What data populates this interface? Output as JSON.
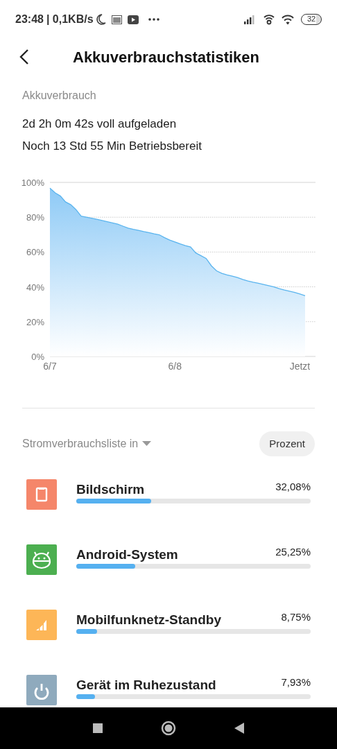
{
  "status_bar": {
    "time": "23:48",
    "speed": "| 0,1KB/s",
    "battery": "32"
  },
  "header": {
    "title": "Akkuverbrauchstatistiken"
  },
  "summary": {
    "label": "Akkuverbrauch",
    "charged": "2d 2h 0m 42s voll aufgeladen",
    "remaining": "Noch 13 Std 55 Min Betriebsbereit"
  },
  "chart_data": {
    "type": "area",
    "grid": true,
    "ylim": [
      0,
      100
    ],
    "categories": [
      "6/7",
      null,
      null,
      null,
      null,
      null,
      null,
      null,
      null,
      null,
      null,
      null,
      null,
      null,
      null,
      null,
      null,
      null,
      null,
      null,
      null,
      null,
      null,
      null,
      "6/8",
      null,
      null,
      null,
      null,
      null,
      null,
      null,
      null,
      null,
      null,
      null,
      null,
      null,
      null,
      null,
      null,
      null,
      null,
      null,
      null,
      null,
      null,
      null,
      "Jetzt",
      null
    ],
    "yticks": [
      {
        "value": 0,
        "label": "0%"
      },
      {
        "value": 20,
        "label": "20%"
      },
      {
        "value": 40,
        "label": "40%"
      },
      {
        "value": 60,
        "label": "60%"
      },
      {
        "value": 80,
        "label": "80%"
      },
      {
        "value": 100,
        "label": "100%"
      }
    ],
    "series": [
      {
        "color": "#5ab4ee",
        "values": [
          96.7,
          94.0,
          92.2,
          88.8,
          87.2,
          84.4,
          80.6,
          80.0,
          79.4,
          78.8,
          78.1,
          77.4,
          76.7,
          76.0,
          74.9,
          73.8,
          73.1,
          72.5,
          71.8,
          71.2,
          70.5,
          69.9,
          68.3,
          66.9,
          65.8,
          64.7,
          63.7,
          62.9,
          59.5,
          57.9,
          56.3,
          52.1,
          49.2,
          47.8,
          46.9,
          46.2,
          45.4,
          44.3,
          43.4,
          42.7,
          42.1,
          41.4,
          40.7,
          40.0,
          39.0,
          38.2,
          37.5,
          36.8,
          35.9,
          34.9
        ]
      }
    ]
  },
  "list": {
    "heading": "Stromverbrauchsliste in",
    "mode_button": "Prozent",
    "items": [
      {
        "kind": "screen",
        "color": "#f5866a",
        "name": "Bildschirm",
        "percent": "32,08%",
        "level": 0.3208
      },
      {
        "kind": "android",
        "color": "#4caf50",
        "name": "Android-System",
        "percent": "25,25%",
        "level": 0.2525
      },
      {
        "kind": "cell",
        "color": "#fdb657",
        "name": "Mobilfunknetz-Standby",
        "percent": "8,75%",
        "level": 0.0875
      },
      {
        "kind": "power",
        "color": "#8faabd",
        "name": "Gerät im Ruhezustand",
        "percent": "7,93%",
        "level": 0.0793
      }
    ]
  }
}
